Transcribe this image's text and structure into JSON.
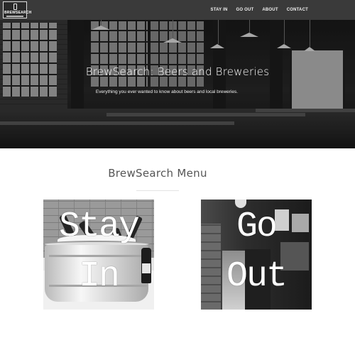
{
  "nav": {
    "logo_text": "BREWSEARCH",
    "links": [
      "STAY IN",
      "GO OUT",
      "ABOUT",
      "CONTACT"
    ]
  },
  "hero": {
    "title": "BrewSearch: Beers and Breweries",
    "subtitle": "Everything you ever wanted to know about beers and local breweries."
  },
  "menu": {
    "title": "BrewSearch Menu",
    "cards": [
      {
        "line1": "Stay",
        "line2": "In"
      },
      {
        "line1": "Go",
        "line2": "Out"
      }
    ]
  },
  "colors": {
    "navbar": "#3a3a3a",
    "nav_text": "#f1f1f1",
    "hero_text": "#ffffff",
    "menu_title": "#555555"
  },
  "icons": [
    "beer-tap-logo-icon"
  ]
}
